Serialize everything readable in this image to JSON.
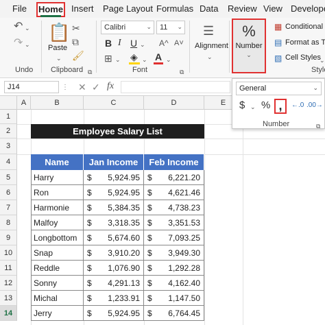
{
  "menu": {
    "tabs": [
      "File",
      "Home",
      "Insert",
      "Page Layout",
      "Formulas",
      "Data",
      "Review",
      "View",
      "Develope"
    ]
  },
  "ribbon": {
    "undo_label": "Undo",
    "clipboard": {
      "paste": "Paste",
      "label": "Clipboard"
    },
    "font": {
      "name": "Calibri",
      "size": "11",
      "label": "Font"
    },
    "alignment": "Alignment",
    "number": {
      "button": "Number"
    },
    "styles": {
      "conditional": "Conditional F",
      "format_table": "Format as Ta",
      "cell_styles": "Cell Styles",
      "label": "Style"
    }
  },
  "formula_bar": {
    "name_box": "J14",
    "formula": ""
  },
  "number_panel": {
    "format": "General",
    "label": "Number"
  },
  "columns": [
    "A",
    "B",
    "C",
    "D",
    "E"
  ],
  "rows": [
    "1",
    "2",
    "3",
    "4",
    "5",
    "6",
    "7",
    "8",
    "9",
    "10",
    "11",
    "12",
    "13",
    "14"
  ],
  "sheet": {
    "title": "Employee Salary List",
    "headers": [
      "Name",
      "Jan Income",
      "Feb Income"
    ],
    "currency": "$",
    "data": [
      [
        "Harry",
        "5,924.95",
        "6,221.20"
      ],
      [
        "Ron",
        "5,924.95",
        "4,621.46"
      ],
      [
        "Harmonie",
        "5,384.35",
        "4,738.23"
      ],
      [
        "Malfoy",
        "3,318.35",
        "3,351.53"
      ],
      [
        "Longbottom",
        "5,674.60",
        "7,093.25"
      ],
      [
        "Snap",
        "3,910.20",
        "3,949.30"
      ],
      [
        "Reddle",
        "1,076.90",
        "1,292.28"
      ],
      [
        "Sonny",
        "4,291.13",
        "4,162.40"
      ],
      [
        "Michal",
        "1,233.91",
        "1,147.50"
      ],
      [
        "Jerry",
        "5,924.95",
        "6,764.45"
      ]
    ]
  },
  "colors": {
    "accent": "#1e7145",
    "header_blue": "#4472c4",
    "highlight": "#e03030"
  }
}
